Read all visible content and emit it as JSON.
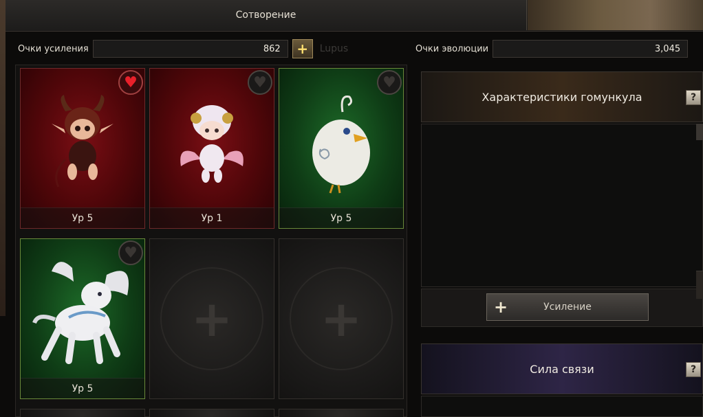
{
  "tabs": {
    "active": "Сотворение"
  },
  "points": {
    "enhance_label": "Очки усиления",
    "enhance_value": "862",
    "enhance_plus": "+",
    "ghost_name": "Lupus",
    "evolution_label": "Очки эволюции",
    "evolution_value": "3,045"
  },
  "cards": [
    {
      "level": "Ур 5",
      "color": "#7a0e14",
      "favorite": true,
      "creature": "demon-imp"
    },
    {
      "level": "Ур 1",
      "color": "#7a0e14",
      "favorite": false,
      "creature": "angel-sheep"
    },
    {
      "level": "Ур 5",
      "color": "#1d6a28",
      "favorite": false,
      "creature": "white-chick"
    },
    {
      "level": "Ур 5",
      "color": "#1d6a28",
      "favorite": false,
      "creature": "winged-pegasus"
    }
  ],
  "empty_slot_symbol": "+",
  "homunculus": {
    "title": "Характеристики гомункула",
    "help": "?"
  },
  "enhance_button": {
    "icon": "+",
    "label": "Усиление"
  },
  "link": {
    "title": "Сила связи",
    "help": "?"
  },
  "heart_symbol": "♥"
}
